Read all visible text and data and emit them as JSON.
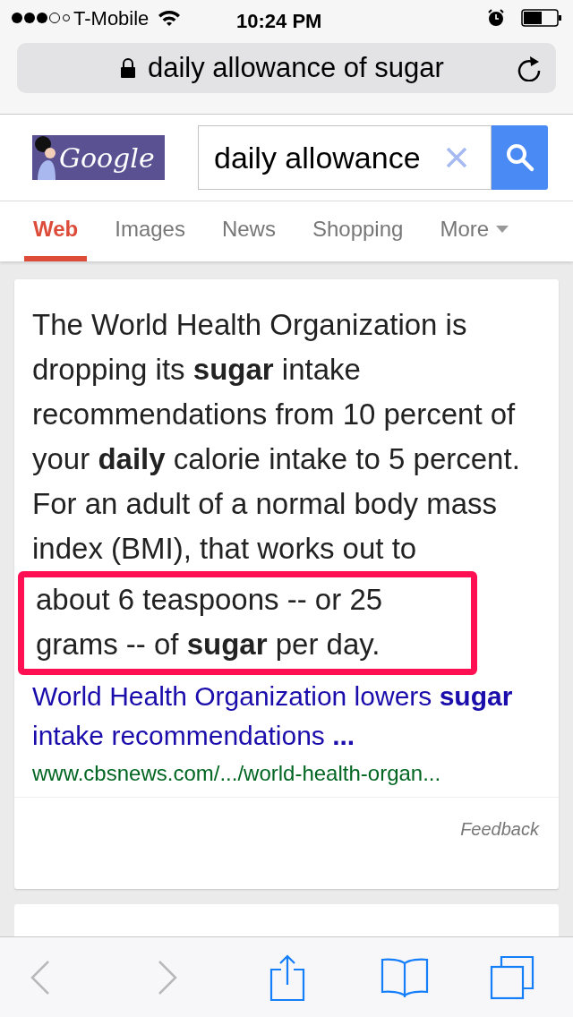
{
  "status_bar": {
    "carrier": "T-Mobile",
    "time": "10:24 PM"
  },
  "url_bar": {
    "text": "daily allowance of sugar"
  },
  "search_header": {
    "logo": "Google",
    "query": "daily allowance"
  },
  "tabs": [
    {
      "label": "Web",
      "selected": true
    },
    {
      "label": "Images",
      "selected": false
    },
    {
      "label": "News",
      "selected": false
    },
    {
      "label": "Shopping",
      "selected": false
    },
    {
      "label": "More",
      "selected": false,
      "kind": "menu"
    }
  ],
  "answer": {
    "snippet": "The World Health Organization is dropping its **sugar** intake recommendations from 10 percent of your **daily** calorie intake to 5 percent. For an adult of a normal body mass index (BMI), that works out to",
    "highlighted": "about 6 teaspoons -- or 25 grams -- of **sugar** per day.",
    "title": "World Health Organization lowers **sugar** intake recommendations **...**",
    "url": "www.cbsnews.com/.../world-health-organ...",
    "feedback": "Feedback"
  },
  "toolbar": {
    "back_disabled": true,
    "forward_disabled": true
  }
}
